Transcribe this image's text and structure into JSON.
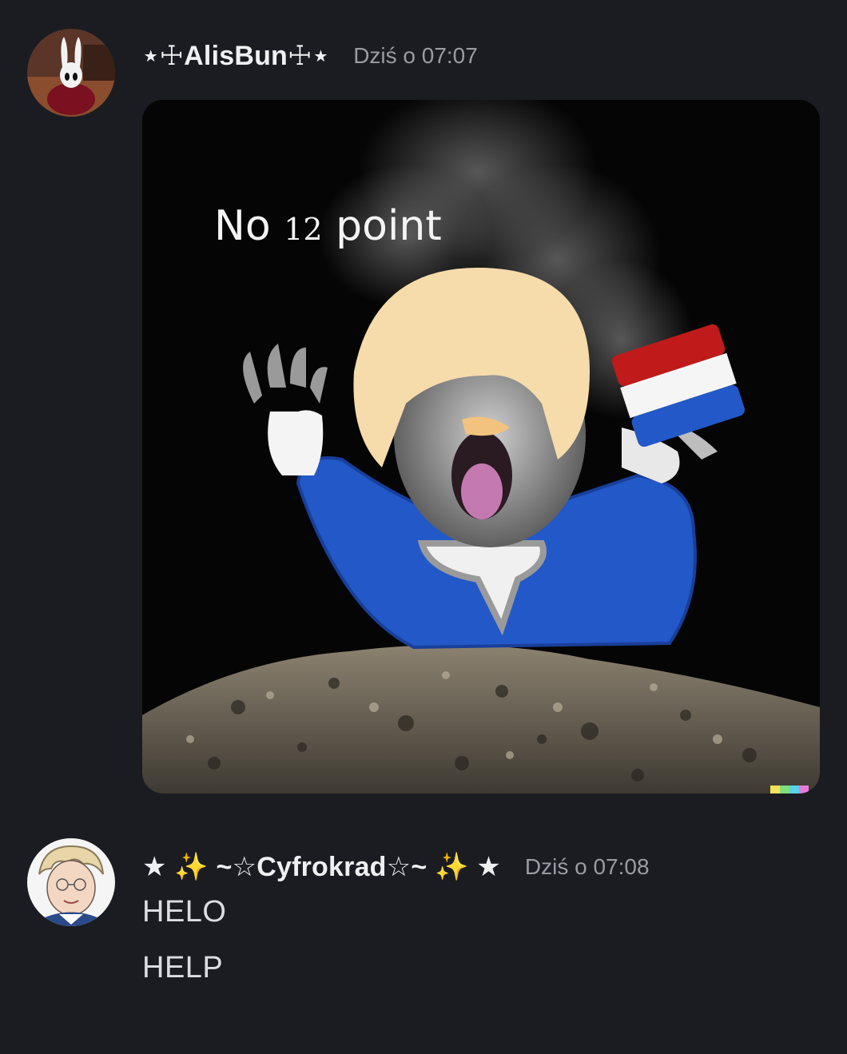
{
  "messages": [
    {
      "author": "⋆☩AlisBun☩⋆",
      "timestamp": "Dziś o 07:07",
      "attachment": {
        "caption_big1": "No ",
        "caption_small": "12",
        "caption_big2": " point"
      }
    },
    {
      "author": "★ ✨ ~☆Cyfrokrad☆~ ✨ ★",
      "timestamp": "Dziś o 07:08",
      "lines": [
        "HELO",
        "HELP"
      ]
    }
  ],
  "colors": {
    "background": "#1b1c21",
    "username": "#f0f0f2",
    "timestamp": "#9a9ca4",
    "text": "#dcdde1"
  }
}
